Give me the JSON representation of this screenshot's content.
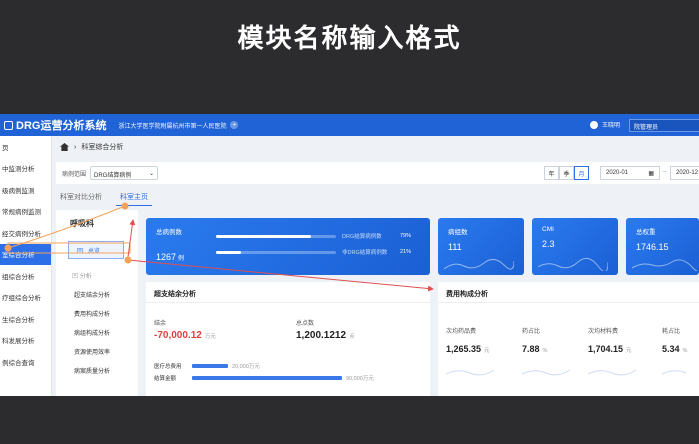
{
  "slide": {
    "title": "模块名称输入格式"
  },
  "app": {
    "title": "DRG运营分析系统",
    "hospital": "浙江大学医学院附属杭州市第一人民医院",
    "user": "王晓明",
    "role": "院管理员"
  },
  "sidebar": {
    "items": [
      "页",
      "中监测分析",
      "级病例监测",
      "常规病例监测",
      "经交病例分析",
      "室综合分析",
      "组综合分析",
      "疗组综合分析",
      "生综合分析",
      "科发展分析",
      "例综合查询"
    ],
    "active_index": 5
  },
  "breadcrumb": {
    "label": "科室综合分析"
  },
  "filter": {
    "label": "病例范围",
    "value": "DRG结算病例",
    "segments": [
      "年",
      "季",
      "月"
    ],
    "active_segment": 2,
    "date_start": "2020-01",
    "date_end": "2020-12"
  },
  "tabs": [
    "科室对比分析",
    "科室主页"
  ],
  "active_tab": 1,
  "subnav": {
    "title": "呼吸科",
    "button_icon": "回",
    "button": "总览",
    "section_icon": "凹",
    "section": "分析",
    "items": [
      "超支结余分析",
      "费用构成分析",
      "病组构成分析",
      "资源使用效率",
      "病案质量分析"
    ]
  },
  "kpis": {
    "total": {
      "title": "总病例数",
      "value": "1267",
      "unit": "例",
      "rows": [
        {
          "label": "DRG结算病例数",
          "pct": "79%",
          "fill": 0.79
        },
        {
          "label": "非DRG结算病例数",
          "pct": "21%",
          "fill": 0.21
        }
      ]
    },
    "groups": {
      "title": "病组数",
      "value": "111"
    },
    "cmi": {
      "title": "CMI",
      "value": "2.3"
    },
    "weight": {
      "title": "总权重",
      "value": "1746.15"
    }
  },
  "settlement": {
    "title": "超支结余分析",
    "balance_label": "结余",
    "balance_value": "-70,000.12",
    "balance_unit": "万元",
    "points_label": "总点数",
    "points_value": "1,200.1212",
    "points_unit": "点",
    "bars": [
      {
        "label": "医疗总费用",
        "value": "20,000万元",
        "fill": 0.24
      },
      {
        "label": "结算金额",
        "value": "90,000万元",
        "fill": 1.0
      }
    ]
  },
  "cost": {
    "title": "费用构成分析",
    "stats": [
      {
        "label": "次均药品费",
        "value": "1,265.35",
        "unit": "元"
      },
      {
        "label": "药占比",
        "value": "7.88",
        "unit": "%"
      },
      {
        "label": "次均材料费",
        "value": "1,704.15",
        "unit": "元"
      },
      {
        "label": "耗占比",
        "value": "5.34",
        "unit": "%"
      }
    ]
  },
  "colors": {
    "brand": "#2063d6",
    "accent": "#2c6fe6",
    "negative": "#e2403c",
    "annotation": "#f5a35a",
    "arrow": "#e05050"
  }
}
